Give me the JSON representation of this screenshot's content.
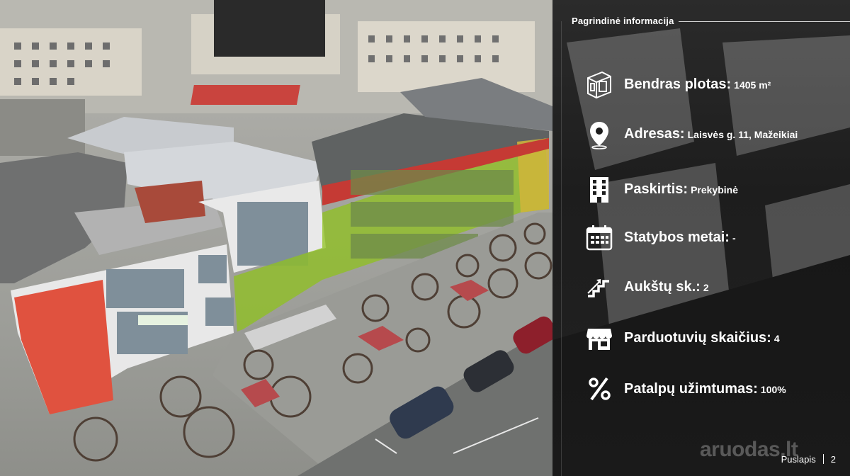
{
  "panel": {
    "header": "Pagrindinė informacija",
    "rows": [
      {
        "icon": "floor-plan-icon",
        "label": "Bendras plotas:",
        "value": "1405 m²"
      },
      {
        "icon": "location-pin-icon",
        "label": "Adresas:",
        "value": "Laisvės g. 11, Mažeikiai"
      },
      {
        "icon": "building-icon",
        "label": "Paskirtis:",
        "value": "Prekybinė"
      },
      {
        "icon": "calendar-icon",
        "label": "Statybos metai:",
        "value": "-"
      },
      {
        "icon": "stairs-icon",
        "label": "Aukštų sk.:",
        "value": "2"
      },
      {
        "icon": "storefront-icon",
        "label": "Parduotuvių skaičius:",
        "value": "4"
      },
      {
        "icon": "percent-icon",
        "label": "Patalpų užimtumas:",
        "value": "100%"
      }
    ]
  },
  "footer": {
    "label": "Puslapis",
    "page": "2"
  },
  "watermark": "aruodas.lt",
  "colors": {
    "highlight": "#8fc21e",
    "panel_bg": "#1d1d1d",
    "text": "#ffffff"
  }
}
